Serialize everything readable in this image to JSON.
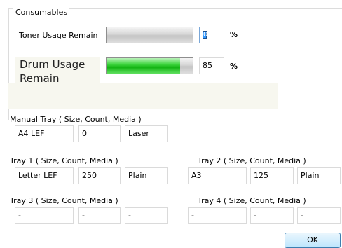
{
  "consumables": {
    "group_title": "Consumables",
    "toner": {
      "label": "Toner Usage Remain",
      "value": "0",
      "unit": "%",
      "level": 0
    },
    "drum": {
      "label": "Drum Usage Remain",
      "value": "85",
      "unit": "%",
      "level": 85
    }
  },
  "manual_tray": {
    "title": "Manual Tray ( Size, Count, Media )",
    "size": "A4 LEF",
    "count": "0",
    "media": "Laser"
  },
  "tray1": {
    "title": "Tray 1 ( Size, Count, Media )",
    "size": "Letter LEF",
    "count": "250",
    "media": "Plain"
  },
  "tray2": {
    "title": "Tray 2 ( Size, Count, Media )",
    "size": "A3",
    "count": "125",
    "media": "Plain"
  },
  "tray3": {
    "title": "Tray 3 ( Size, Count, Media )",
    "size": "-",
    "count": "-",
    "media": "-"
  },
  "tray4": {
    "title": "Tray 4 ( Size, Count, Media )",
    "size": "-",
    "count": "-",
    "media": "-"
  },
  "buttons": {
    "ok": "OK"
  },
  "colors": {
    "drum_bar": "#12b312",
    "selection": "#3399ff",
    "beige_panel": "#f7f7ef"
  }
}
